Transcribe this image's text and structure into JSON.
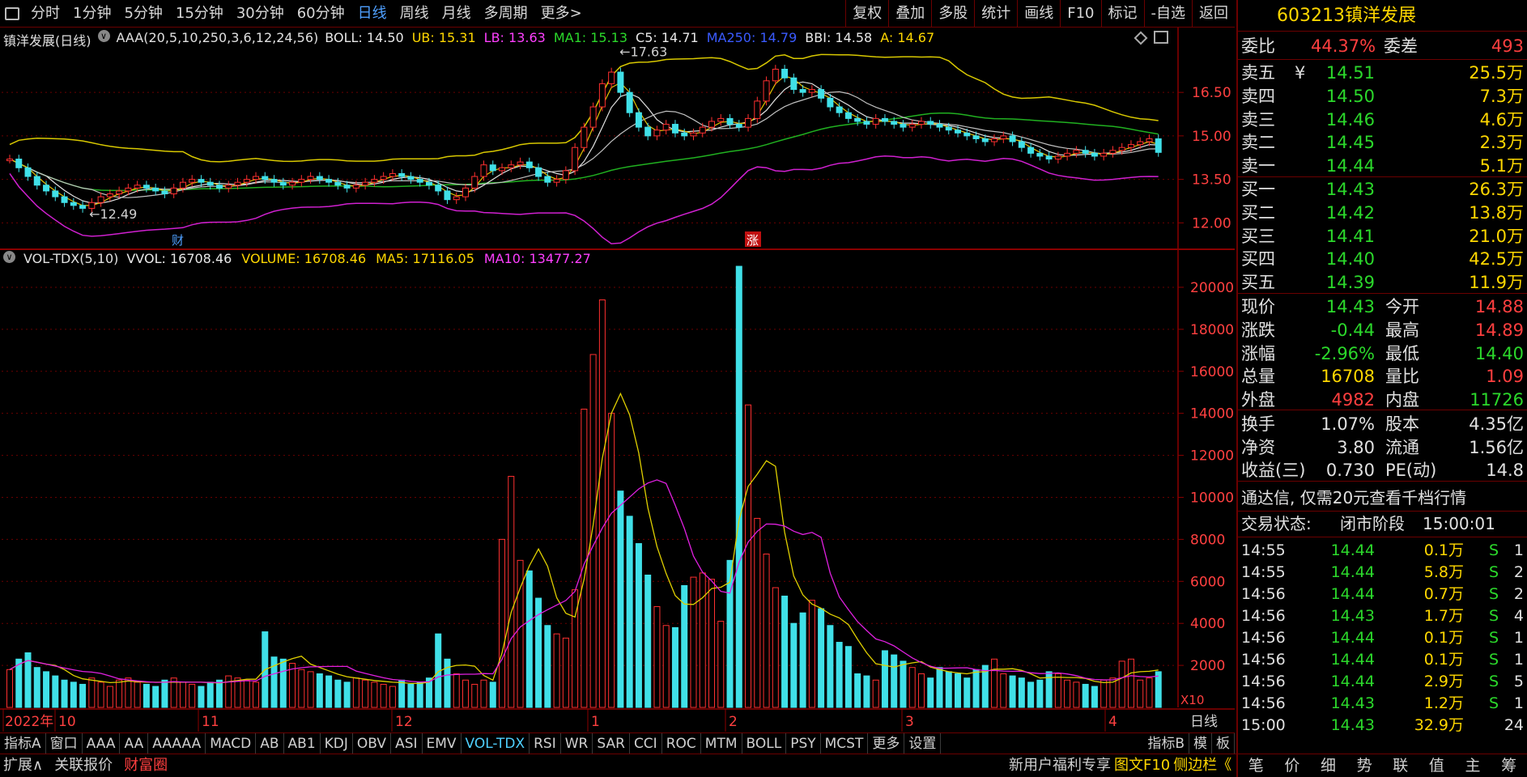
{
  "toolbar": {
    "menu_icon": "menu-icon",
    "periods": [
      "分时",
      "1分钟",
      "5分钟",
      "15分钟",
      "30分钟",
      "60分钟",
      "日线",
      "周线",
      "月线",
      "多周期",
      "更多>"
    ],
    "active_period": "日线",
    "right_buttons": [
      "复权",
      "叠加",
      "多股",
      "统计",
      "画线",
      "F10",
      "标记",
      "-自选",
      "返回"
    ]
  },
  "main_legend": {
    "title": "镇洋发展(日线)",
    "indicator": "AAA(20,5,10,250,3,6,12,24,56)",
    "items": [
      {
        "label": "BOLL: 14.50",
        "color": "#e8e8e8"
      },
      {
        "label": "UB: 15.31",
        "color": "#ffd700"
      },
      {
        "label": "LB: 13.63",
        "color": "#ff3fff"
      },
      {
        "label": "MA1: 15.13",
        "color": "#2bd82b"
      },
      {
        "label": "C5: 14.71",
        "color": "#e8e8e8"
      },
      {
        "label": "MA250: 14.79",
        "color": "#3a5bff"
      },
      {
        "label": "BBI: 14.58",
        "color": "#e8e8e8"
      },
      {
        "label": "A: 14.67",
        "color": "#ffd700"
      }
    ]
  },
  "main_axis": {
    "ticks": [
      "16.50",
      "15.00",
      "13.50",
      "12.00"
    ]
  },
  "annotations": {
    "high": "17.63",
    "low": "12.49",
    "cai": "财",
    "zhang": "涨"
  },
  "vol_legend": {
    "indicator": "VOL-TDX(5,10)",
    "items": [
      {
        "label": "VVOL: 16708.46",
        "color": "#e8e8e8"
      },
      {
        "label": "VOLUME: 16708.46",
        "color": "#ffd700"
      },
      {
        "label": "MA5: 17116.05",
        "color": "#ffd700"
      },
      {
        "label": "MA10: 13477.27",
        "color": "#ff3fff"
      }
    ]
  },
  "vol_axis": {
    "ticks": [
      "20000",
      "18000",
      "16000",
      "14000",
      "12000",
      "10000",
      "8000",
      "6000",
      "4000",
      "2000"
    ],
    "unit": "X10"
  },
  "x_axis": {
    "labels": [
      "2022年",
      "10",
      "11",
      "12",
      "1",
      "2",
      "3",
      "4"
    ],
    "period": "日线"
  },
  "chart_data": {
    "type": "candlestick",
    "title": "镇洋发展(日线)",
    "price_range": [
      11.2,
      17.9
    ],
    "volume_range": [
      0,
      21000
    ],
    "series": [
      {
        "name": "close",
        "values": [
          14.2,
          13.9,
          13.6,
          13.3,
          13.1,
          12.9,
          12.7,
          12.6,
          12.5,
          12.7,
          12.9,
          13.0,
          13.1,
          13.2,
          13.3,
          13.2,
          13.1,
          13.0,
          13.2,
          13.4,
          13.5,
          13.4,
          13.3,
          13.2,
          13.3,
          13.4,
          13.5,
          13.6,
          13.5,
          13.4,
          13.3,
          13.4,
          13.5,
          13.6,
          13.5,
          13.4,
          13.3,
          13.2,
          13.3,
          13.4,
          13.5,
          13.6,
          13.7,
          13.6,
          13.5,
          13.4,
          13.3,
          13.1,
          12.8,
          12.9,
          13.2,
          13.6,
          14.0,
          13.8,
          13.9,
          14.0,
          14.1,
          13.9,
          13.6,
          13.4,
          13.5,
          13.8,
          14.6,
          15.3,
          16.0,
          16.8,
          17.2,
          16.5,
          15.8,
          15.3,
          15.0,
          15.2,
          15.4,
          15.1,
          15.0,
          15.1,
          15.3,
          15.5,
          15.6,
          15.4,
          15.3,
          15.6,
          16.2,
          16.9,
          17.3,
          17.0,
          16.6,
          16.5,
          16.6,
          16.3,
          16.0,
          15.8,
          15.6,
          15.5,
          15.4,
          15.6,
          15.5,
          15.4,
          15.3,
          15.4,
          15.5,
          15.4,
          15.3,
          15.2,
          15.1,
          15.0,
          14.9,
          14.8,
          14.9,
          15.0,
          14.8,
          14.6,
          14.4,
          14.3,
          14.2,
          14.3,
          14.4,
          14.5,
          14.4,
          14.3,
          14.4,
          14.5,
          14.6,
          14.7,
          14.8,
          14.9,
          14.43
        ]
      },
      {
        "name": "volume",
        "values": [
          1800,
          2300,
          2600,
          1900,
          1700,
          1500,
          1300,
          1200,
          1100,
          1400,
          1200,
          1000,
          1300,
          1400,
          1200,
          1100,
          1000,
          1300,
          1400,
          1200,
          1100,
          1000,
          1200,
          1300,
          1500,
          1400,
          1300,
          1200,
          3600,
          2400,
          2300,
          2100,
          1800,
          1700,
          1600,
          1500,
          1300,
          1200,
          1400,
          1300,
          1200,
          1100,
          1000,
          1300,
          1100,
          1200,
          1400,
          3500,
          2300,
          1600,
          1300,
          1100,
          1300,
          1200,
          8000,
          11000,
          7000,
          6500,
          5200,
          3900,
          3500,
          3300,
          5600,
          14200,
          16800,
          19400,
          14000,
          10300,
          9100,
          7800,
          6300,
          4800,
          3900,
          3800,
          5800,
          6200,
          6400,
          6100,
          4100,
          7000,
          21000,
          14400,
          9000,
          7300,
          5700,
          5300,
          4000,
          4500,
          5100,
          4700,
          3900,
          3100,
          2900,
          1600,
          1500,
          1300,
          2700,
          2500,
          2200,
          1900,
          1600,
          1400,
          1900,
          1700,
          1600,
          1400,
          1800,
          2000,
          2300,
          1600,
          1500,
          1400,
          1200,
          1300,
          1700,
          1600,
          1300,
          1200,
          1100,
          1000,
          1300,
          1400,
          2200,
          2300,
          1300,
          1400,
          1700
        ]
      }
    ]
  },
  "right_panel": {
    "code": "603213",
    "name": "镇洋发展",
    "weibi": {
      "label": "委比",
      "value": "44.37%",
      "label2": "委差",
      "value2": "493"
    },
    "sell": [
      {
        "label": "卖五",
        "price": "14.51",
        "vol": "25.5万",
        "mark": "¥"
      },
      {
        "label": "卖四",
        "price": "14.50",
        "vol": "7.3万"
      },
      {
        "label": "卖三",
        "price": "14.46",
        "vol": "4.6万"
      },
      {
        "label": "卖二",
        "price": "14.45",
        "vol": "2.3万"
      },
      {
        "label": "卖一",
        "price": "14.44",
        "vol": "5.1万"
      }
    ],
    "buy": [
      {
        "label": "买一",
        "price": "14.43",
        "vol": "26.3万"
      },
      {
        "label": "买二",
        "price": "14.42",
        "vol": "13.8万"
      },
      {
        "label": "买三",
        "price": "14.41",
        "vol": "21.0万"
      },
      {
        "label": "买四",
        "price": "14.40",
        "vol": "42.5万"
      },
      {
        "label": "买五",
        "price": "14.39",
        "vol": "11.9万"
      }
    ],
    "stats1": [
      {
        "l1": "现价",
        "v1": "14.43",
        "c1": "g",
        "l2": "今开",
        "v2": "14.88",
        "c2": "r"
      },
      {
        "l1": "涨跌",
        "v1": "-0.44",
        "c1": "g",
        "l2": "最高",
        "v2": "14.89",
        "c2": "r"
      },
      {
        "l1": "涨幅",
        "v1": "-2.96%",
        "c1": "g",
        "l2": "最低",
        "v2": "14.40",
        "c2": "g"
      },
      {
        "l1": "总量",
        "v1": "16708",
        "c1": "y",
        "l2": "量比",
        "v2": "1.09",
        "c2": "r"
      },
      {
        "l1": "外盘",
        "v1": "4982",
        "c1": "r",
        "l2": "内盘",
        "v2": "11726",
        "c2": "g"
      }
    ],
    "stats2": [
      {
        "l1": "换手",
        "v1": "1.07%",
        "l2": "股本",
        "v2": "4.35亿"
      },
      {
        "l1": "净资",
        "v1": "3.80",
        "l2": "流通",
        "v2": "1.56亿"
      },
      {
        "l1": "收益(三)",
        "v1": "0.730",
        "l2": "PE(动)",
        "v2": "14.8"
      }
    ],
    "promo": "通达信, 仅需20元查看千档行情",
    "status": {
      "label": "交易状态:",
      "value": "闭市阶段",
      "time": "15:00:01"
    },
    "ticks": [
      {
        "t": "14:55",
        "p": "14.44",
        "v": "0.1万",
        "s": "S",
        "n": "1"
      },
      {
        "t": "14:55",
        "p": "14.44",
        "v": "5.8万",
        "s": "S",
        "n": "2"
      },
      {
        "t": "14:56",
        "p": "14.44",
        "v": "0.7万",
        "s": "S",
        "n": "2"
      },
      {
        "t": "14:56",
        "p": "14.43",
        "v": "1.7万",
        "s": "S",
        "n": "4"
      },
      {
        "t": "14:56",
        "p": "14.44",
        "v": "0.1万",
        "s": "S",
        "n": "1"
      },
      {
        "t": "14:56",
        "p": "14.44",
        "v": "0.1万",
        "s": "S",
        "n": "1"
      },
      {
        "t": "14:56",
        "p": "14.44",
        "v": "2.9万",
        "s": "S",
        "n": "5"
      },
      {
        "t": "14:56",
        "p": "14.43",
        "v": "1.2万",
        "s": "S",
        "n": "1"
      },
      {
        "t": "15:00",
        "p": "14.43",
        "v": "32.9万",
        "s": "",
        "n": "24"
      }
    ]
  },
  "indicator_tabs": [
    "指标A",
    "窗口",
    "AAA",
    "AA",
    "AAAAA",
    "MACD",
    "AB",
    "AB1",
    "KDJ",
    "OBV",
    "ASI",
    "EMV",
    "VOL-TDX",
    "RSI",
    "WR",
    "SAR",
    "CCI",
    "ROC",
    "MTM",
    "BOLL",
    "PSY",
    "MCST",
    "更多",
    "设置"
  ],
  "active_indicator": "VOL-TDX",
  "indicator_right": [
    "指标B",
    "模",
    "板"
  ],
  "bottom_left": [
    {
      "label": "扩展∧",
      "color": "#d0d0d0"
    },
    {
      "label": "关联报价",
      "color": "#d0d0d0"
    },
    {
      "label": "财富圈",
      "color": "#ff3f3f"
    }
  ],
  "bottom_right": [
    {
      "label": "新用户福利专享",
      "color": "#d0d0d0"
    },
    {
      "label": "图文F10",
      "color": "#ffd700"
    },
    {
      "label": "侧边栏《",
      "color": "#ffd700"
    }
  ],
  "side_tabs": [
    "笔",
    "价",
    "细",
    "势",
    "联",
    "值",
    "主",
    "筹"
  ],
  "period_right": "日线",
  "zoom_buttons": [
    "+",
    "-"
  ]
}
